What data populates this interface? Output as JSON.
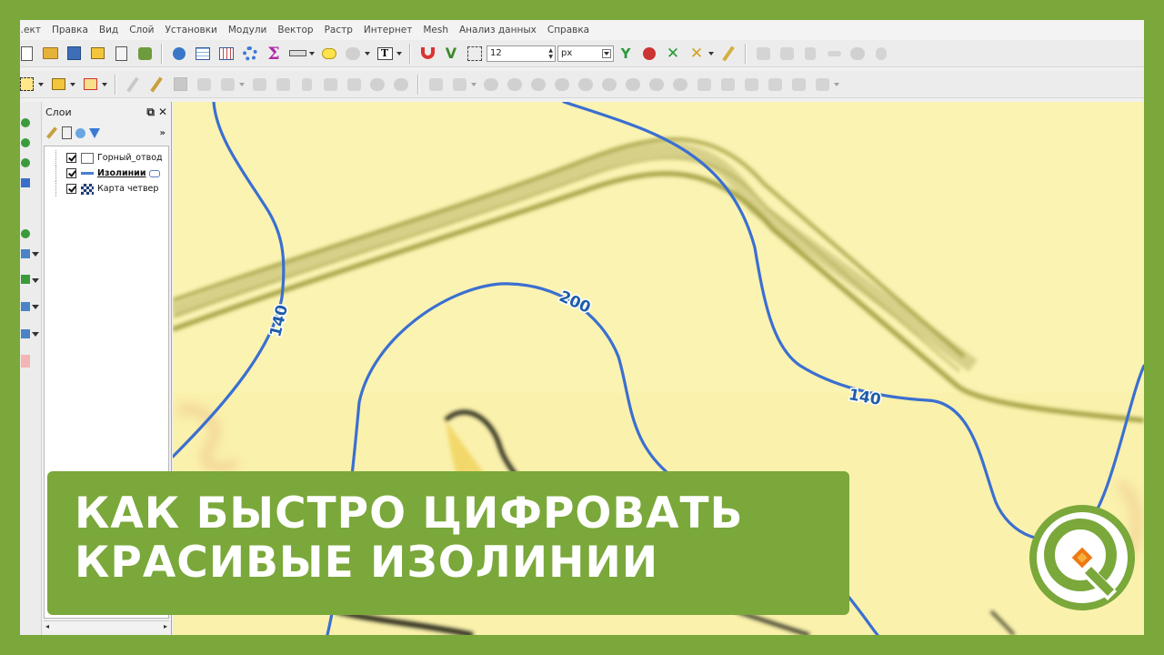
{
  "menu": [
    "...ект",
    "Правка",
    "Вид",
    "Слой",
    "Установки",
    "Модули",
    "Вектор",
    "Растр",
    "Интернет",
    "Mesh",
    "Анализ данных",
    "Справка"
  ],
  "snapping": {
    "tolerance": "12",
    "unit": "px"
  },
  "layers_panel": {
    "title": "Слои",
    "float_icon": "⧉",
    "close_icon": "✕",
    "more_icon": "»",
    "items": [
      {
        "name": "Горный_отвод",
        "type": "polygon",
        "checked": true
      },
      {
        "name": "Изолинии",
        "type": "line",
        "checked": true,
        "active": true
      },
      {
        "name": "Карта четвер",
        "type": "raster",
        "checked": true
      }
    ],
    "scroll_left": "◂",
    "scroll_right": "▸"
  },
  "map": {
    "contour_labels": [
      "140",
      "200",
      "140"
    ],
    "colors": {
      "contour": "#3b6fd1",
      "background": "#fbf3b2",
      "road": "#a6a64a"
    }
  },
  "overlay": {
    "line1": "КАК БЫСТРО ЦИФРОВАТЬ",
    "line2": "КРАСИВЫЕ ИЗОЛИНИИ"
  },
  "brand": {
    "accent": "#7aa83a"
  }
}
